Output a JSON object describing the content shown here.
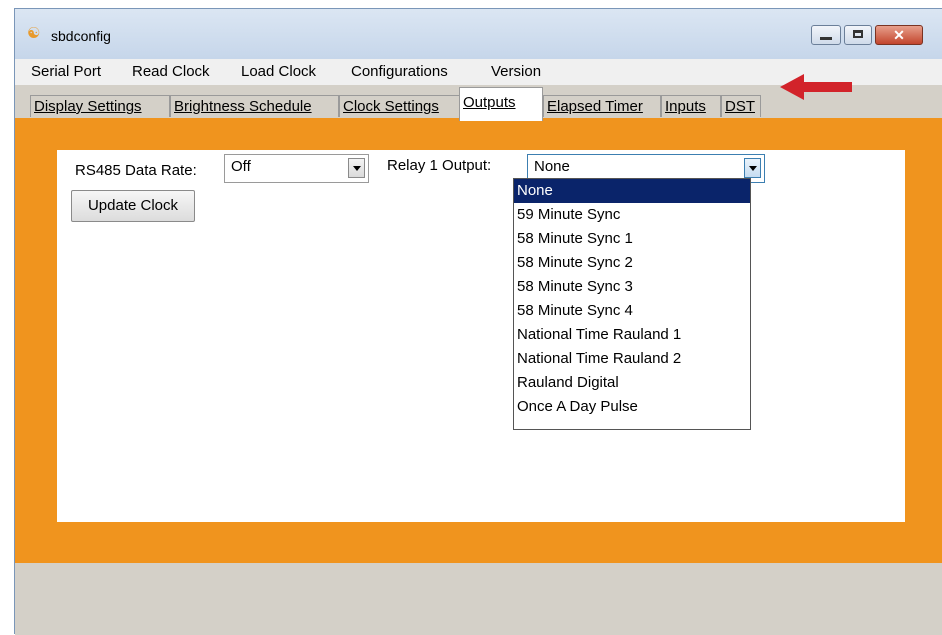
{
  "window": {
    "title": "sbdconfig"
  },
  "menu": [
    "Serial Port",
    "Read Clock",
    "Load Clock",
    "Configurations",
    "Version"
  ],
  "tabs": [
    "Display Settings",
    "Brightness Schedule",
    "Clock Settings",
    "Outputs",
    "Elapsed Timer",
    "Inputs",
    "DST"
  ],
  "outputs": {
    "rs485_label": "RS485 Data Rate:",
    "rs485_value": "Off",
    "relay_label": "Relay 1 Output:",
    "relay_value": "None",
    "update_button": "Update Clock",
    "relay_options": [
      "None",
      "59 Minute Sync",
      "58 Minute Sync 1",
      "58 Minute Sync 2",
      "58 Minute Sync 3",
      "58 Minute Sync 4",
      "National Time Rauland 1",
      "National Time Rauland 2",
      "Rauland Digital",
      "Once A Day Pulse"
    ],
    "selected_option_index": 0
  },
  "colors": {
    "tab_panel_background": "#f0941e",
    "annotation_arrow": "#d2232a",
    "selection": "#0a246a"
  }
}
